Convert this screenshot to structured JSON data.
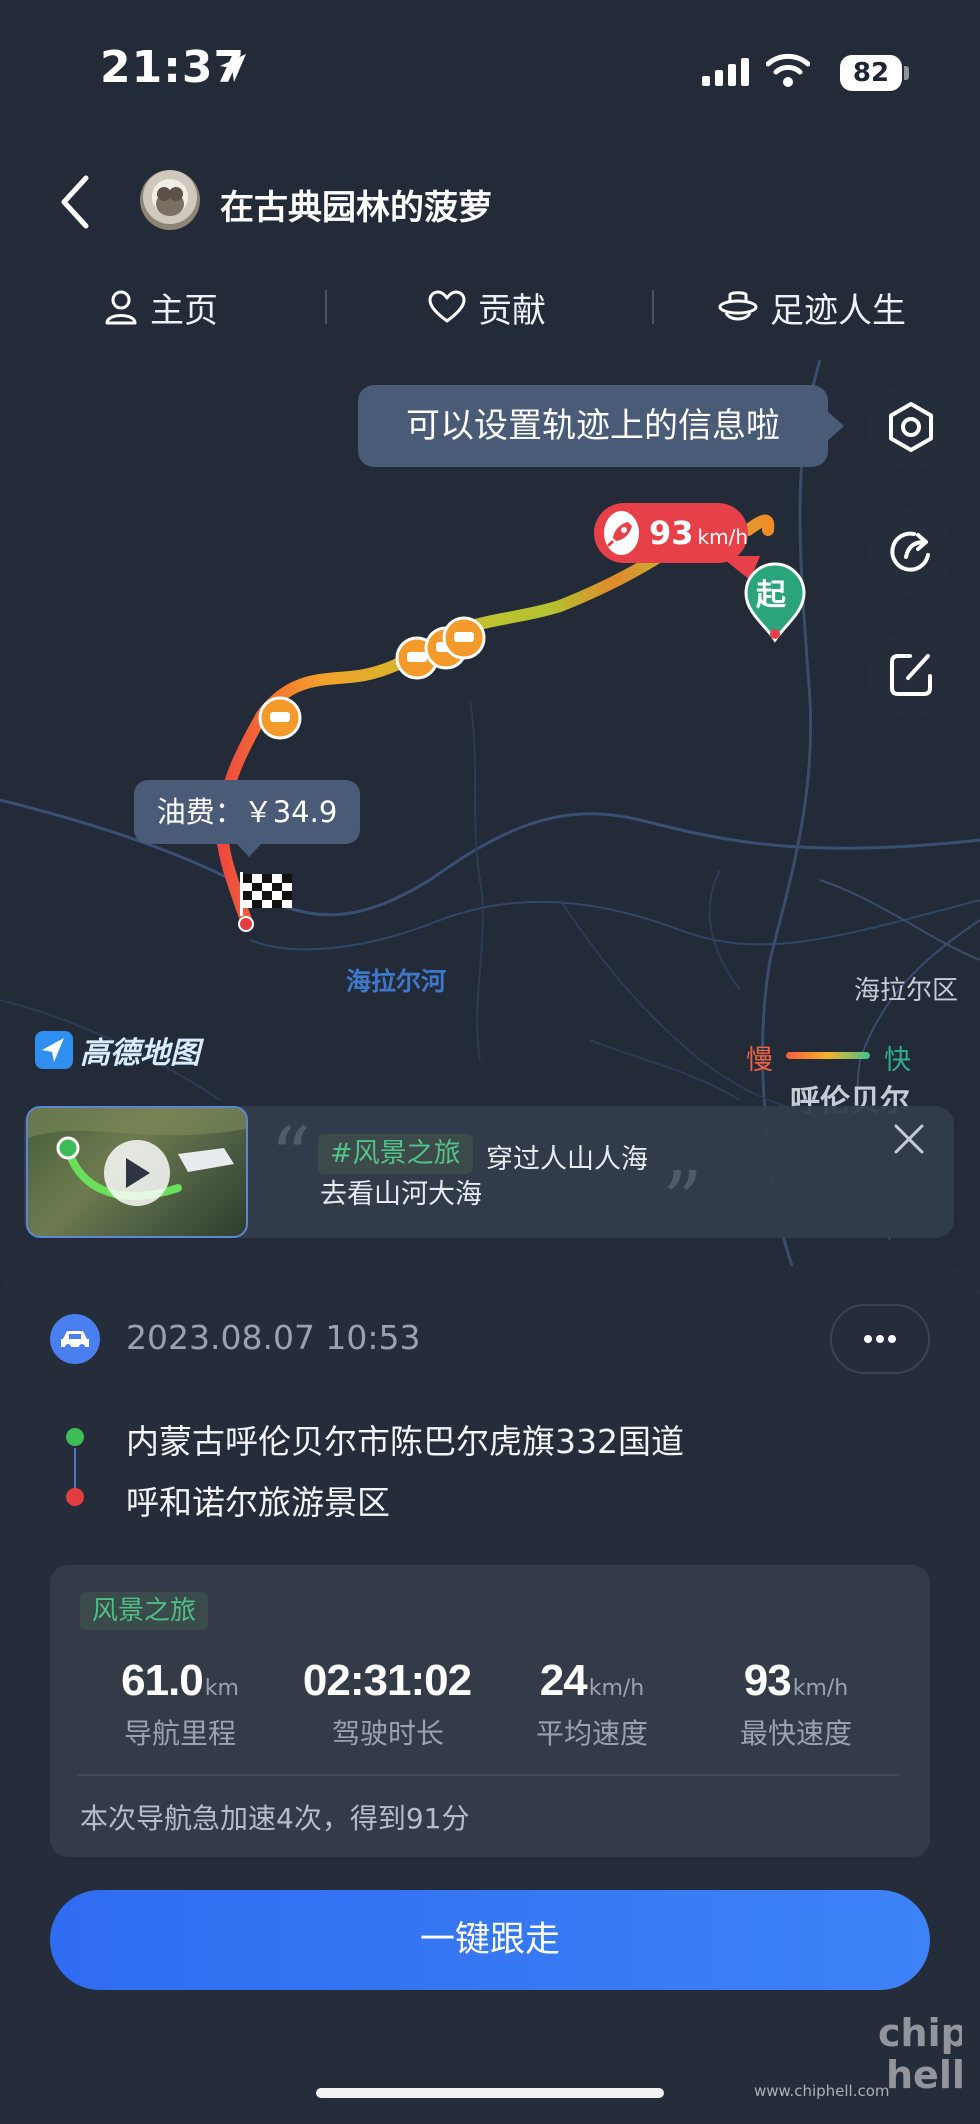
{
  "status_bar": {
    "time": "21:37",
    "battery": "82"
  },
  "header": {
    "profile_name": "在古典园林的菠萝"
  },
  "tabs": [
    {
      "label": "主页",
      "icon": "person-icon"
    },
    {
      "label": "贡献",
      "icon": "heart-icon"
    },
    {
      "label": "足迹人生",
      "icon": "footprint-hat-icon"
    }
  ],
  "map": {
    "tooltip": "可以设置轨迹上的信息啦",
    "speed_value": "93",
    "speed_unit": "km/h",
    "start_label": "起",
    "fuel": "油费：￥34.9",
    "river_label": "海拉尔河",
    "district_label": "海拉尔区",
    "city_label": "呼伦贝尔",
    "provider": "高德地图",
    "legend": {
      "slow": "慢",
      "fast": "快"
    },
    "colors": {
      "slow": "#f55d3b",
      "mid": "#f3b32b",
      "fast": "#44c089"
    }
  },
  "scenic": {
    "tag": "#风景之旅",
    "line1": "穿过人山人海",
    "line2": "去看山河大海"
  },
  "trip": {
    "date": "2023.08.07 10:53",
    "start_address": "内蒙古呼伦贝尔市陈巴尔虎旗332国道",
    "end_address": "呼和诺尔旅游景区",
    "tag": "风景之旅",
    "stats": [
      {
        "value": "61.0",
        "unit": "km",
        "label": "导航里程"
      },
      {
        "value": "02:31:02",
        "unit": "",
        "label": "驾驶时长"
      },
      {
        "value": "24",
        "unit": "km/h",
        "label": "平均速度"
      },
      {
        "value": "93",
        "unit": "km/h",
        "label": "最快速度"
      }
    ],
    "summary": "本次导航急加速4次，得到91分"
  },
  "actions": {
    "follow": "一键跟走"
  },
  "watermark": {
    "brand": "chip hell",
    "url": "www.chiphell.com"
  }
}
